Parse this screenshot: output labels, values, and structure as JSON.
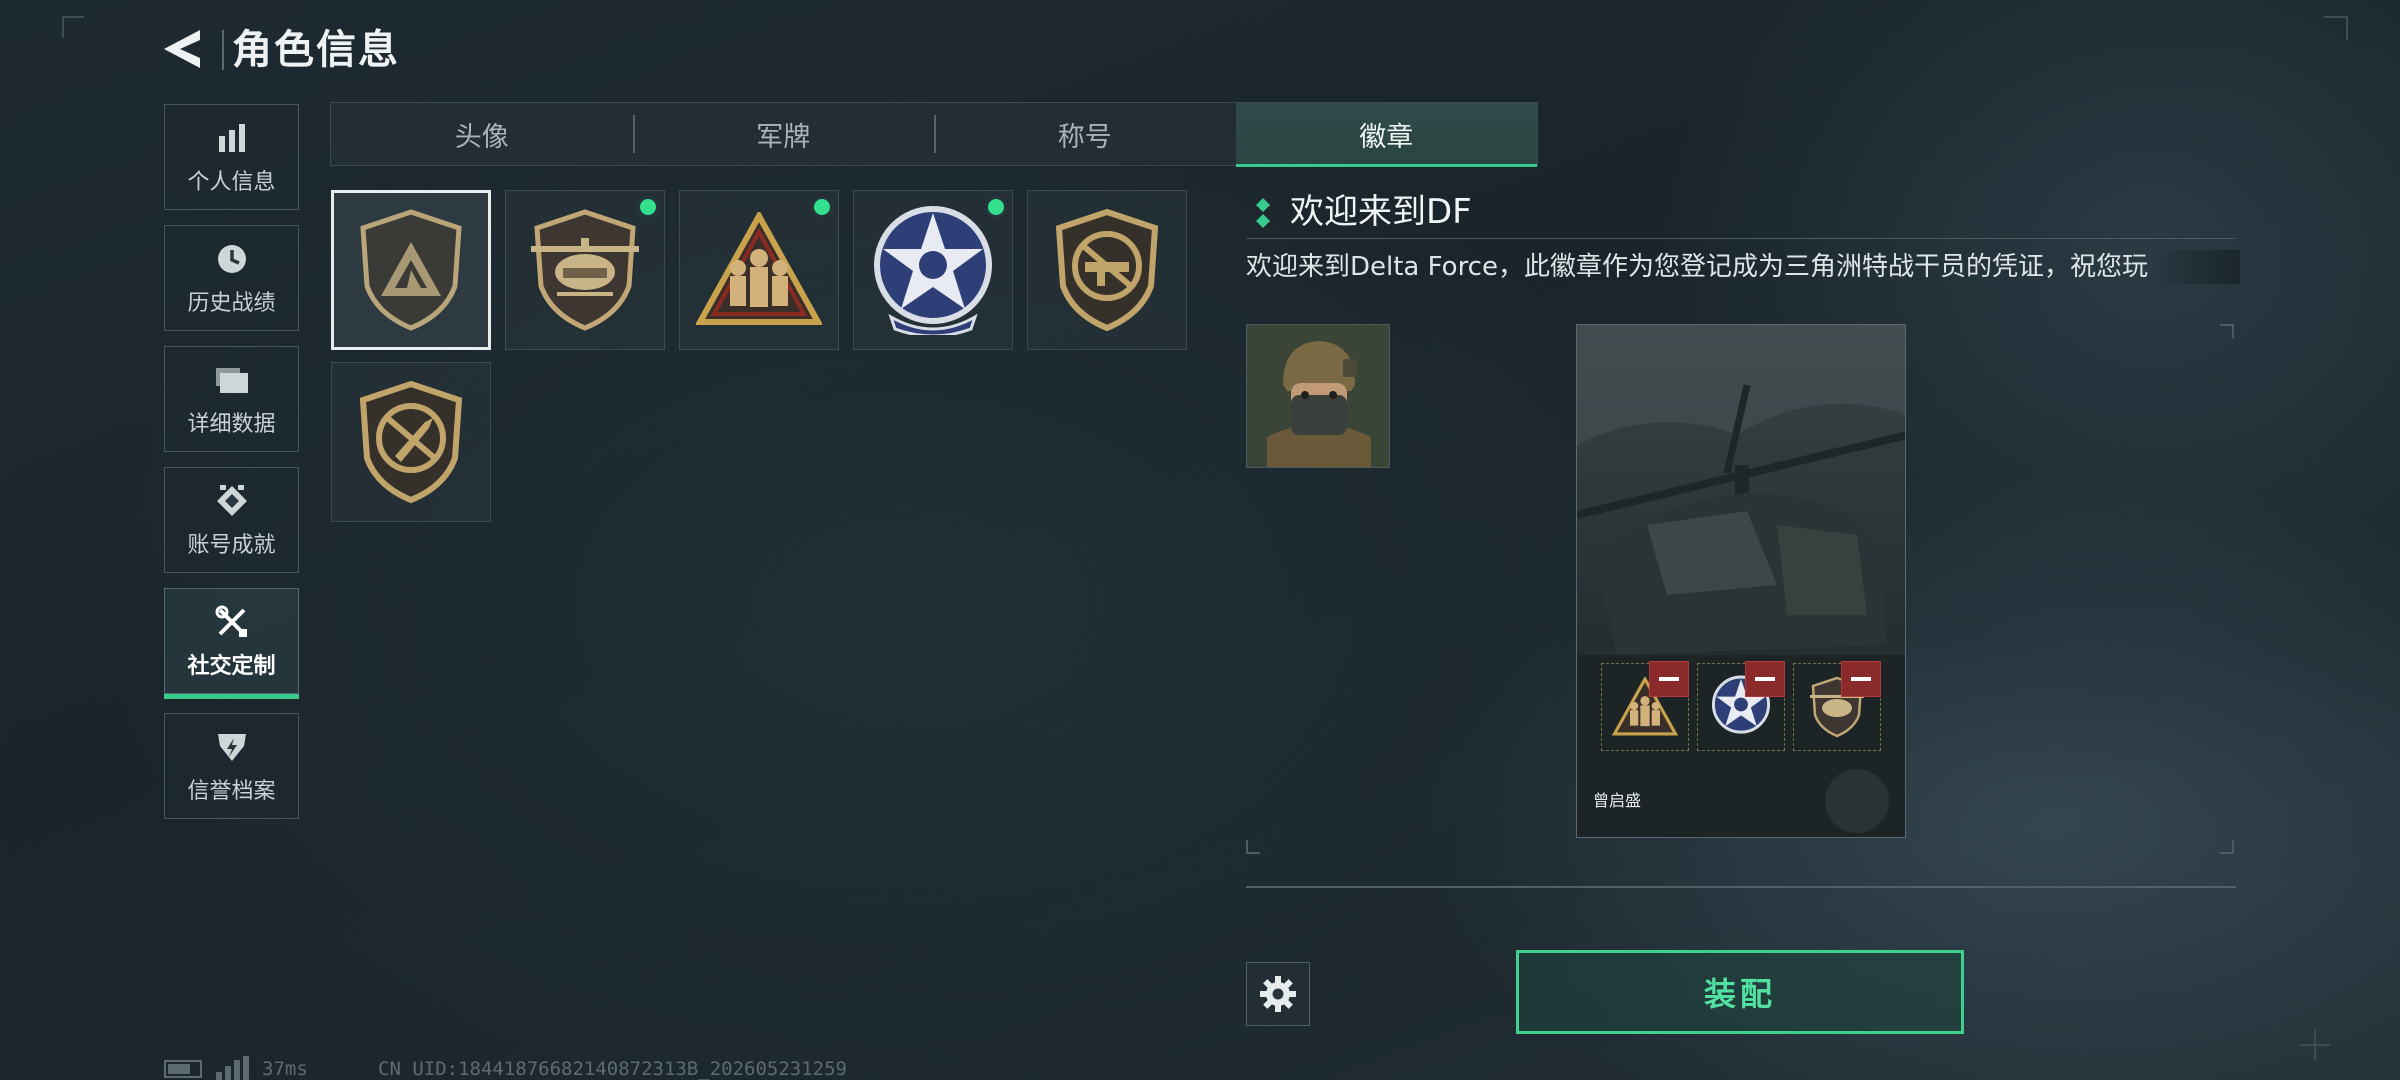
{
  "header": {
    "title": "角色信息"
  },
  "sidebar": {
    "items": [
      {
        "label": "个人信息",
        "icon": "bar-chart-icon"
      },
      {
        "label": "历史战绩",
        "icon": "clock-icon"
      },
      {
        "label": "详细数据",
        "icon": "folder-icon"
      },
      {
        "label": "账号成就",
        "icon": "achievement-icon"
      },
      {
        "label": "社交定制",
        "icon": "tools-icon",
        "active": true
      },
      {
        "label": "信誉档案",
        "icon": "shield-bolt-icon"
      }
    ]
  },
  "tabs": [
    {
      "label": "头像"
    },
    {
      "label": "军牌"
    },
    {
      "label": "称号"
    },
    {
      "label": "徽章",
      "active": true
    }
  ],
  "badges": [
    {
      "name": "delta-badge",
      "selected": true,
      "new": false
    },
    {
      "name": "helicopter-badge",
      "selected": false,
      "new": true
    },
    {
      "name": "squad-triangle-badge",
      "selected": false,
      "new": true
    },
    {
      "name": "star-badge",
      "selected": false,
      "new": true
    },
    {
      "name": "rifle-badge",
      "selected": false,
      "new": false
    },
    {
      "name": "knife-badge",
      "selected": false,
      "new": false
    }
  ],
  "detail": {
    "title": "欢迎来到DF",
    "description": "欢迎来到Delta Force，此徽章作为您登记成为三角洲特战干员的凭证，祝您玩"
  },
  "preview": {
    "player_name": "曾启盛"
  },
  "actions": {
    "equip_label": "装配"
  },
  "status": {
    "ping": "37ms",
    "uid": "CN UID:18441876682140872313B_202605231259"
  },
  "colors": {
    "accent": "#38c98d",
    "new_dot": "#33e08e",
    "remove": "#8a2a2a"
  }
}
